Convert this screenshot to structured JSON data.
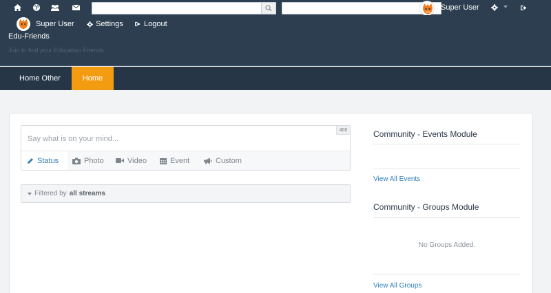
{
  "toolbar": {
    "icons": [
      "home-icon",
      "globe-icon",
      "users-icon",
      "envelope-icon",
      "gear-icon",
      "sign-out-icon"
    ],
    "search1_placeholder": "",
    "search2_placeholder": "",
    "username": "Super User"
  },
  "header": {
    "user_label": "Super User",
    "settings_label": "Settings",
    "logout_label": "Logout",
    "site_title": "Edu-Friends",
    "tagline": "Join to find your Education Friends"
  },
  "nav": {
    "tabs": [
      {
        "label": "Home Other",
        "active": false
      },
      {
        "label": "Home",
        "active": true
      }
    ]
  },
  "composer": {
    "placeholder": "Say what is on your mind...",
    "char_count": "400",
    "tabs": [
      {
        "label": "Status",
        "icon": "pencil-icon",
        "active": true
      },
      {
        "label": "Photo",
        "icon": "camera-icon",
        "active": false
      },
      {
        "label": "Video",
        "icon": "video-camera-icon",
        "active": false
      },
      {
        "label": "Event",
        "icon": "calendar-icon",
        "active": false
      },
      {
        "label": "Custom",
        "icon": "bullhorn-icon",
        "active": false
      }
    ]
  },
  "filter": {
    "prefix": "Filtered by",
    "value": "all streams"
  },
  "modules": {
    "events_title": "Community - Events Module",
    "events_link": "View All Events",
    "groups_title": "Community - Groups Module",
    "groups_empty": "No Groups Added.",
    "groups_link": "View All Groups"
  },
  "colors": {
    "header_bg": "#2d3e50",
    "nav_bg": "#263647",
    "accent": "#f39c12",
    "link": "#2f7fb8"
  }
}
